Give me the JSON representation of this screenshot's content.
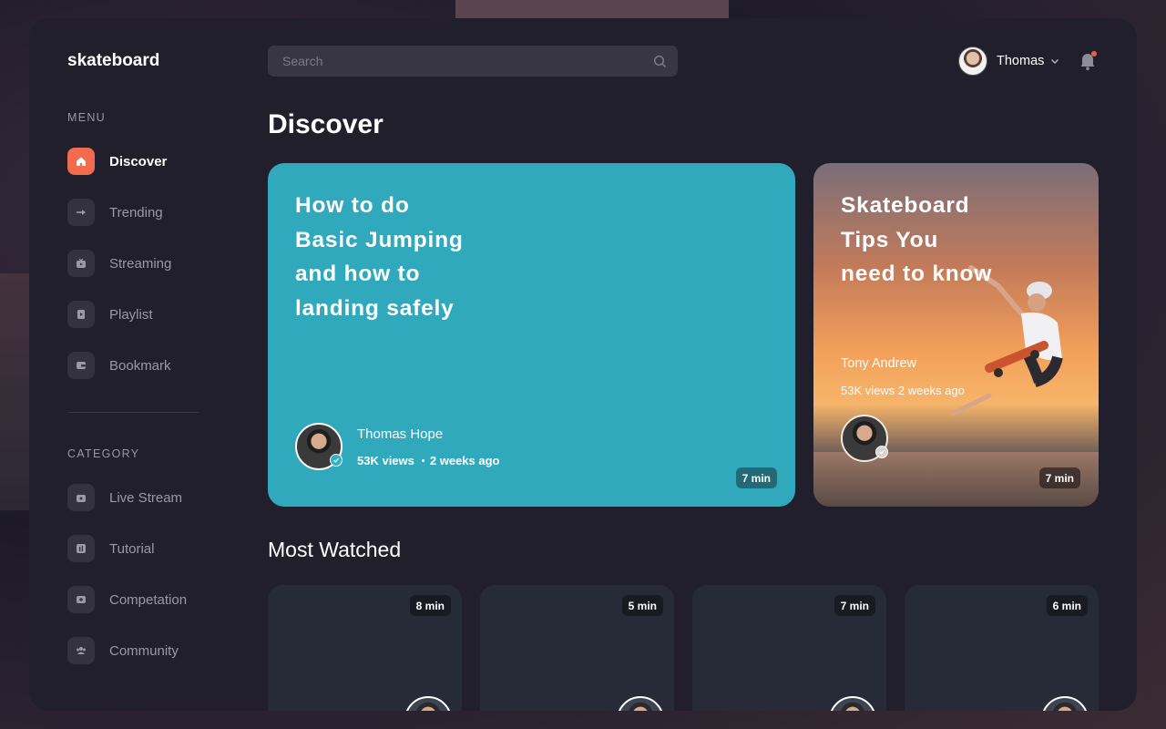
{
  "app": {
    "logo": "skateboard"
  },
  "sidebar": {
    "menu_label": "MENU",
    "menu_items": [
      {
        "label": "Discover",
        "icon": "home-icon",
        "active": true
      },
      {
        "label": "Trending",
        "icon": "trending-icon",
        "active": false
      },
      {
        "label": "Streaming",
        "icon": "streaming-icon",
        "active": false
      },
      {
        "label": "Playlist",
        "icon": "playlist-icon",
        "active": false
      },
      {
        "label": "Bookmark",
        "icon": "bookmark-icon",
        "active": false
      }
    ],
    "category_label": "CATEGORY",
    "category_items": [
      {
        "label": "Live Stream",
        "icon": "live-stream-icon"
      },
      {
        "label": "Tutorial",
        "icon": "tutorial-icon"
      },
      {
        "label": "Competation",
        "icon": "competition-icon"
      },
      {
        "label": "Community",
        "icon": "community-icon"
      }
    ]
  },
  "header": {
    "search_placeholder": "Search",
    "user_name": "Thomas",
    "notification_dot": true
  },
  "main": {
    "page_title": "Discover",
    "featured": [
      {
        "title": "How to do Basic Jumping and how to landing safely",
        "author": "Thomas Hope",
        "views": "53K views",
        "age": "2 weeks ago",
        "duration": "7 min",
        "color": "#30a9bd"
      },
      {
        "title": "Skateboard Tips You need to know",
        "author": "Tony Andrew",
        "meta": "53K views 2 weeks ago",
        "duration": "7 min"
      }
    ],
    "most_watched_title": "Most Watched",
    "most_watched": [
      {
        "duration": "8 min"
      },
      {
        "duration": "5 min"
      },
      {
        "duration": "7 min"
      },
      {
        "duration": "6 min"
      }
    ]
  },
  "colors": {
    "accent": "#f26b4f",
    "app_background": "#221f2c",
    "featured_card": "#30a9bd"
  }
}
